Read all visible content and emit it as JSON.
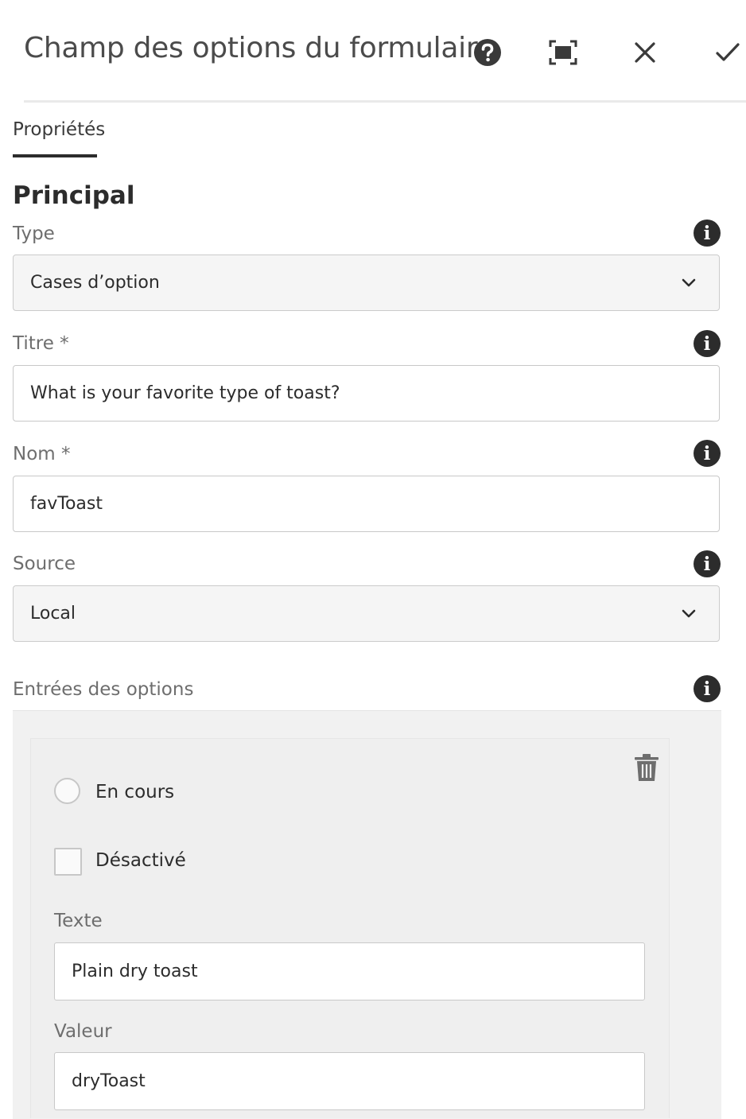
{
  "header": {
    "title": "Champ des options du formulaire",
    "icons": [
      "help-icon",
      "fullscreen-icon",
      "close-icon",
      "confirm-icon"
    ]
  },
  "tabs": [
    {
      "label": "Propriétés",
      "active": true
    }
  ],
  "section": {
    "heading": "Principal"
  },
  "fields": {
    "type": {
      "label": "Type",
      "value": "Cases d’option"
    },
    "titre": {
      "label": "Titre *",
      "value": "What is your favorite type of toast?"
    },
    "nom": {
      "label": "Nom *",
      "value": "favToast"
    },
    "source": {
      "label": "Source",
      "value": "Local"
    }
  },
  "options": {
    "label": "Entrées des options",
    "items": [
      {
        "default_label": "En cours",
        "disabled_label": "Désactivé",
        "text_label": "Texte",
        "text_value": "Plain dry toast",
        "value_label": "Valeur",
        "value_value": "dryToast"
      }
    ]
  },
  "info_glyph": "i",
  "colors": {
    "text": "#2c2c2c",
    "muted": "#6e6e6e",
    "border": "#c8c8c8",
    "panel": "#f1f1f1"
  }
}
